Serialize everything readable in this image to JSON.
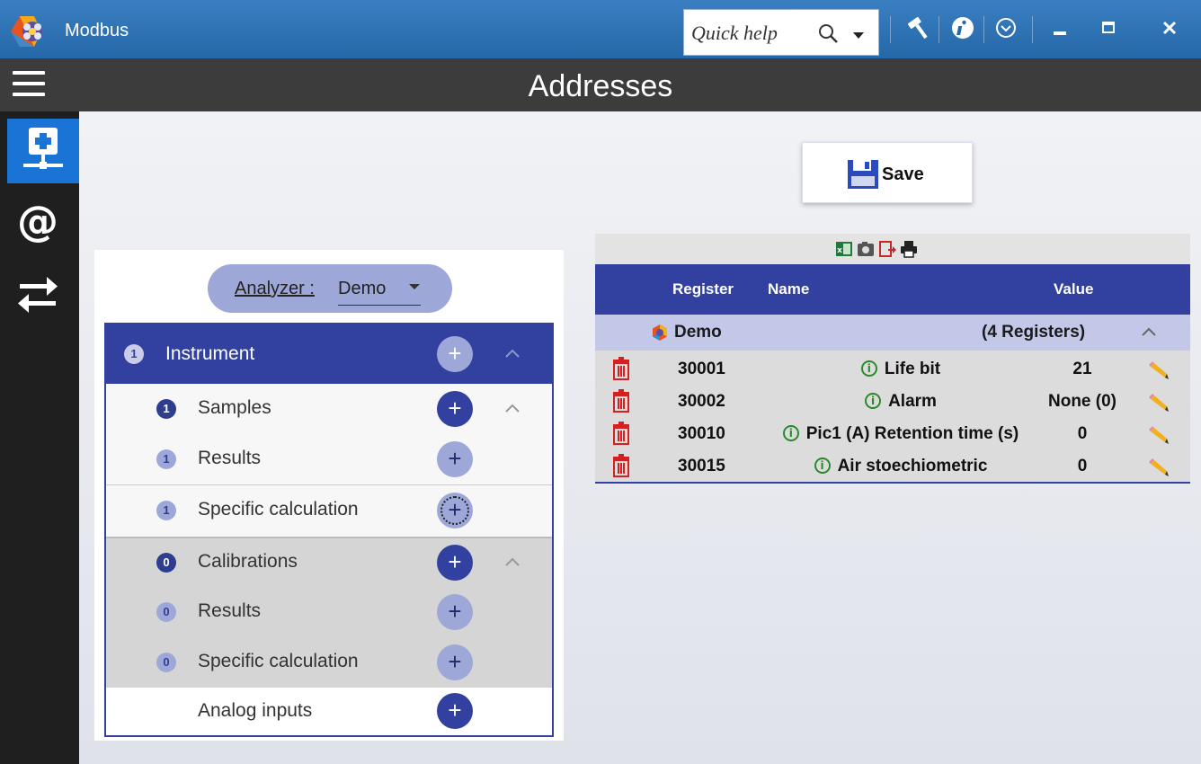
{
  "window": {
    "title": "Modbus",
    "quick_help_placeholder": "Quick help"
  },
  "header": {
    "title": "Addresses"
  },
  "toolbar": {
    "save_label": "Save"
  },
  "analyzer": {
    "label": "Analyzer :",
    "value": "Demo"
  },
  "tree": {
    "instrument": {
      "count": "1",
      "label": "Instrument"
    },
    "samples": {
      "count": "1",
      "label": "Samples"
    },
    "samples_results": {
      "count": "1",
      "label": "Results"
    },
    "samples_specific": {
      "count": "1",
      "label": "Specific calculation"
    },
    "calibrations": {
      "count": "0",
      "label": "Calibrations"
    },
    "calibrations_results": {
      "count": "0",
      "label": "Results"
    },
    "calibrations_specific": {
      "count": "0",
      "label": "Specific calculation"
    },
    "analog_inputs": {
      "label": "Analog inputs"
    },
    "plus_symbol": "+"
  },
  "table": {
    "columns": {
      "register": "Register",
      "name": "Name",
      "value": "Value"
    },
    "group": {
      "name": "Demo",
      "count": "(4 Registers)"
    },
    "info_symbol": "i",
    "rows": [
      {
        "register": "30001",
        "name": "Life bit",
        "value": "21"
      },
      {
        "register": "30002",
        "name": "Alarm",
        "value": "None (0)"
      },
      {
        "register": "30010",
        "name": "Pic1 (A) Retention time (s)",
        "value": "0"
      },
      {
        "register": "30015",
        "name": "Air stoechiometric",
        "value": "0"
      }
    ]
  },
  "colors": {
    "titlebar": "#2468a8",
    "header": "#3c3c3c",
    "rail": "#1f1f1f",
    "rail_active": "#1a74d6",
    "primary": "#3241a0",
    "primary_light": "#9ea8d8",
    "group_row": "#c4c8e8",
    "delete_red": "#d42020",
    "info_green": "#2a8a2a"
  },
  "icons": {
    "app": "app-logo-icon",
    "search": "search-icon",
    "settings": "hammer-icon",
    "about": "info-icon",
    "options": "chevron-circle-icon",
    "save": "floppy-disk-icon",
    "export_excel": "excel-icon",
    "screenshot": "camera-icon",
    "export": "export-icon",
    "print": "printer-icon",
    "delete": "trash-icon",
    "edit": "pencil-icon"
  }
}
